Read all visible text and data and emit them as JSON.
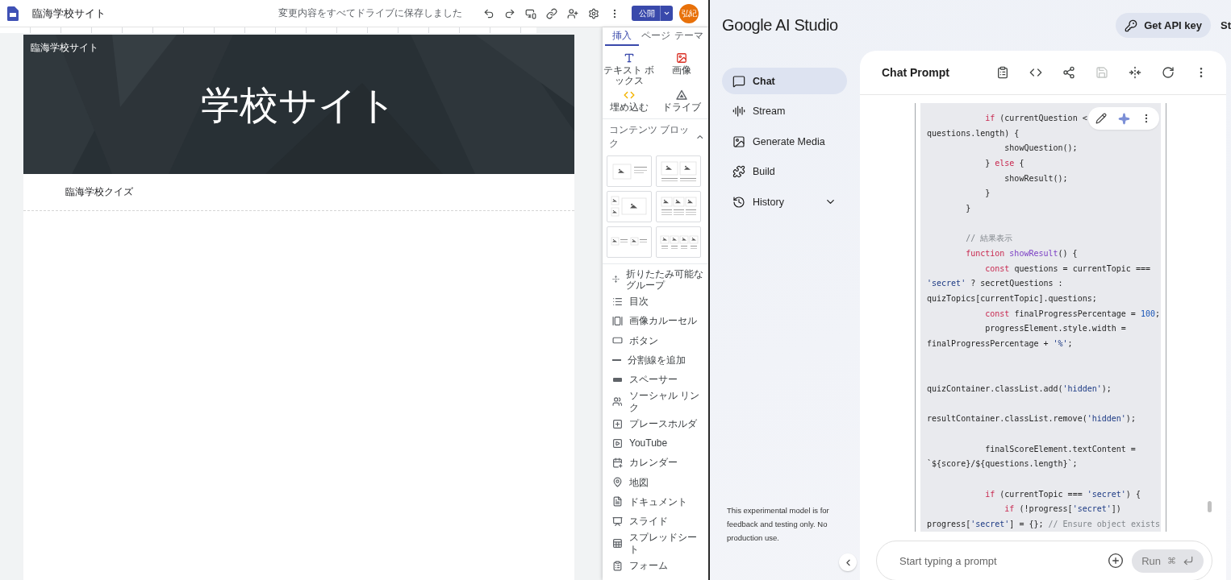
{
  "sites": {
    "toolbar": {
      "title": "臨海学校サイト",
      "save_status": "変更内容をすべてドライブに保存しました",
      "publish": "公開",
      "avatar": "弘紀"
    },
    "banner": {
      "site_name": "臨海学校サイト",
      "heading": "学校サイト"
    },
    "section_text": "臨海学校クイズ",
    "panel": {
      "tabs": [
        {
          "label": "挿入",
          "selected": true
        },
        {
          "label": "ページ",
          "selected": false
        },
        {
          "label": "テーマ",
          "selected": false
        }
      ],
      "insert_items": [
        {
          "label": "テキスト ボックス",
          "kind": "text"
        },
        {
          "label": "画像",
          "kind": "image"
        },
        {
          "label": "埋め込む",
          "kind": "embed"
        },
        {
          "label": "ドライブ",
          "kind": "drive"
        }
      ],
      "content_blocks": {
        "title": "コンテンツ ブロック",
        "expanded": true,
        "layouts": [
          {
            "kind": "image-text"
          },
          {
            "kind": "two-images"
          },
          {
            "kind": "image-grid"
          },
          {
            "kind": "three-columns"
          },
          {
            "kind": "image-text-pairs"
          },
          {
            "kind": "four-columns"
          }
        ]
      },
      "elements": [
        {
          "label": "折りたたみ可能なグループ",
          "kind": "collapsible"
        },
        {
          "label": "目次",
          "kind": "toc"
        },
        {
          "label": "画像カルーセル",
          "kind": "carousel"
        },
        {
          "label": "ボタン",
          "kind": "button"
        },
        {
          "label": "分割線を追加",
          "kind": "divider"
        },
        {
          "label": "スペーサー",
          "kind": "spacer"
        },
        {
          "label": "ソーシャル リンク",
          "kind": "social"
        },
        {
          "label": "プレースホルダ",
          "kind": "placeholder"
        },
        {
          "label": "YouTube",
          "kind": "youtube"
        },
        {
          "label": "カレンダー",
          "kind": "calendar"
        },
        {
          "label": "地図",
          "kind": "map"
        },
        {
          "label": "ドキュメント",
          "kind": "document"
        },
        {
          "label": "スライド",
          "kind": "slides"
        },
        {
          "label": "スプレッドシート",
          "kind": "sheets"
        },
        {
          "label": "フォーム",
          "kind": "forms"
        }
      ]
    }
  },
  "studio": {
    "logo": "Google AI Studio",
    "api_key_button": "Get API key",
    "cut_link": "St",
    "nav": [
      {
        "label": "Chat",
        "kind": "chat",
        "selected": true
      },
      {
        "label": "Stream",
        "kind": "stream",
        "selected": false
      },
      {
        "label": "Generate Media",
        "kind": "media",
        "selected": false
      },
      {
        "label": "Build",
        "kind": "build",
        "selected": false
      },
      {
        "label": "History",
        "kind": "history",
        "selected": false
      }
    ],
    "disclaimer": "This experimental model is for feedback and testing only. No production use.",
    "chat": {
      "title": "Chat Prompt",
      "code_lines": [
        {
          "kind": "code",
          "tokens": [
            {
              "text": "            if",
              "kind": "keyword"
            },
            {
              "text": " (currentQuestion <",
              "kind": "plain"
            }
          ]
        },
        {
          "kind": "code",
          "tokens": [
            {
              "text": "questions.length) {",
              "kind": "plain"
            }
          ]
        },
        {
          "kind": "code",
          "tokens": [
            {
              "text": "                showQuestion();",
              "kind": "plain"
            }
          ]
        },
        {
          "kind": "code",
          "tokens": [
            {
              "text": "            } ",
              "kind": "plain"
            },
            {
              "text": "else",
              "kind": "keyword"
            },
            {
              "text": " {",
              "kind": "plain"
            }
          ]
        },
        {
          "kind": "code",
          "tokens": [
            {
              "text": "                showResult();",
              "kind": "plain"
            }
          ]
        },
        {
          "kind": "code",
          "tokens": [
            {
              "text": "            }",
              "kind": "plain"
            }
          ]
        },
        {
          "kind": "code",
          "tokens": [
            {
              "text": "        }",
              "kind": "plain"
            }
          ]
        },
        {
          "kind": "blank"
        },
        {
          "kind": "code",
          "tokens": [
            {
              "text": "        // 結果表示",
              "kind": "comment"
            }
          ]
        },
        {
          "kind": "code",
          "tokens": [
            {
              "text": "        function",
              "kind": "keyword"
            },
            {
              "text": " showResult",
              "kind": "function"
            },
            {
              "text": "() {",
              "kind": "plain"
            }
          ]
        },
        {
          "kind": "code",
          "tokens": [
            {
              "text": "            const",
              "kind": "keyword"
            },
            {
              "text": " questions = currentTopic ===",
              "kind": "plain"
            }
          ]
        },
        {
          "kind": "code",
          "tokens": [
            {
              "text": "'secret'",
              "kind": "string"
            },
            {
              "text": " ? secretQuestions :",
              "kind": "plain"
            }
          ]
        },
        {
          "kind": "code",
          "tokens": [
            {
              "text": "quizTopics[currentTopic].questions;",
              "kind": "plain"
            }
          ]
        },
        {
          "kind": "code",
          "tokens": [
            {
              "text": "            const",
              "kind": "keyword"
            },
            {
              "text": " finalProgressPercentage = ",
              "kind": "plain"
            },
            {
              "text": "100",
              "kind": "number"
            },
            {
              "text": ";",
              "kind": "plain"
            }
          ]
        },
        {
          "kind": "code",
          "tokens": [
            {
              "text": "            progressElement.style.width =",
              "kind": "plain"
            }
          ]
        },
        {
          "kind": "code",
          "tokens": [
            {
              "text": "finalProgressPercentage + ",
              "kind": "plain"
            },
            {
              "text": "'%'",
              "kind": "string"
            },
            {
              "text": ";",
              "kind": "plain"
            }
          ]
        },
        {
          "kind": "blank"
        },
        {
          "kind": "blank"
        },
        {
          "kind": "code",
          "tokens": [
            {
              "text": "quizContainer.classList.add(",
              "kind": "plain"
            },
            {
              "text": "'hidden'",
              "kind": "string"
            },
            {
              "text": ");",
              "kind": "plain"
            }
          ]
        },
        {
          "kind": "blank"
        },
        {
          "kind": "code",
          "tokens": [
            {
              "text": "resultContainer.classList.remove(",
              "kind": "plain"
            },
            {
              "text": "'hidden'",
              "kind": "string"
            },
            {
              "text": ");",
              "kind": "plain"
            }
          ]
        },
        {
          "kind": "blank"
        },
        {
          "kind": "code",
          "tokens": [
            {
              "text": "            finalScoreElement.textContent =",
              "kind": "plain"
            }
          ]
        },
        {
          "kind": "code",
          "tokens": [
            {
              "text": "`${score}/${questions.length}`;",
              "kind": "plain"
            }
          ]
        },
        {
          "kind": "blank"
        },
        {
          "kind": "code",
          "tokens": [
            {
              "text": "            if",
              "kind": "keyword"
            },
            {
              "text": " (currentTopic === ",
              "kind": "plain"
            },
            {
              "text": "'secret'",
              "kind": "string"
            },
            {
              "text": ") {",
              "kind": "plain"
            }
          ]
        },
        {
          "kind": "code",
          "tokens": [
            {
              "text": "                if",
              "kind": "keyword"
            },
            {
              "text": " (!progress[",
              "kind": "plain"
            },
            {
              "text": "'secret'",
              "kind": "string"
            },
            {
              "text": "])",
              "kind": "plain"
            }
          ]
        },
        {
          "kind": "code",
          "tokens": [
            {
              "text": "progress[",
              "kind": "plain"
            },
            {
              "text": "'secret'",
              "kind": "string"
            },
            {
              "text": "] = {}; ",
              "kind": "plain"
            },
            {
              "text": "// Ensure object exists",
              "kind": "comment"
            }
          ]
        }
      ]
    },
    "prompt": {
      "placeholder": "Start typing a prompt",
      "run_button": "Run",
      "shortcut": "⌘"
    }
  }
}
